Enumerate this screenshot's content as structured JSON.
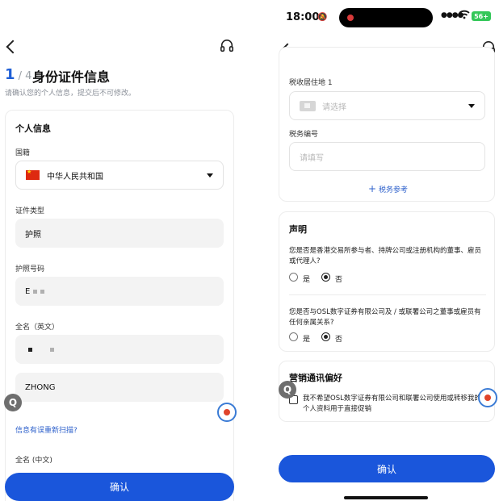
{
  "left": {
    "step_current": "1",
    "step_total": "/ 4",
    "title": "身份证件信息",
    "subtitle": "请确认您的个人信息，提交后不可修改。",
    "section_title": "个人信息",
    "nationality_label": "国籍",
    "nationality_value": "中华人民共和国",
    "doc_type_label": "证件类型",
    "doc_type_value": "护照",
    "passport_label": "护照号码",
    "passport_value": "E",
    "fullname_en_label": "全名（英文）",
    "surname_value": "ZHONG",
    "rescan_link": "信息有误重新扫描?",
    "fullname_cn_label": "全名 (中文)",
    "confirm_label": "确认"
  },
  "right": {
    "status": {
      "time": "18:00",
      "battery": "56+"
    },
    "tax_residence_label": "税收居住地 1",
    "tax_residence_placeholder": "请选择",
    "tax_number_label": "税务编号",
    "tax_number_placeholder": "请填写",
    "tax_reference_link": "税务参考",
    "declaration_title": "声明",
    "q1": "您是否是香港交易所参与者、持牌公司或注册机构的董事、雇员或代理人?",
    "q2": "您是否与OSL数字证券有限公司及 / 或联署公司之董事或雇员有任何亲属关系?",
    "yes": "是",
    "no": "否",
    "marketing_title": "营销通讯偏好",
    "marketing_text": "我不希望OSL数字证券有限公司和联署公司使用或转移我的个人资料用于直接促销",
    "confirm_label": "确认"
  },
  "floating": {
    "q_label": "Q"
  }
}
